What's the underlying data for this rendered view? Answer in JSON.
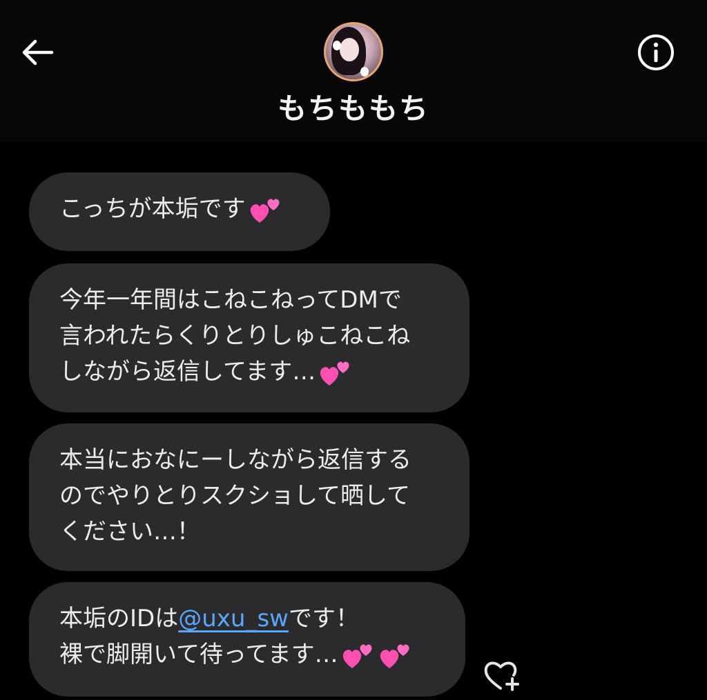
{
  "header": {
    "back_icon": "arrow-left-icon",
    "info_icon": "info-circle-icon",
    "display_name": "もちももち"
  },
  "messages": [
    {
      "lines": [
        "こっちが本垢です"
      ],
      "trailing_emoji": "two-hearts"
    },
    {
      "lines": [
        "今年一年間はこねこねってDMで",
        "言われたらくりとりしゅこねこね",
        "しながら返信してます…"
      ],
      "trailing_emoji": "two-hearts"
    },
    {
      "lines": [
        "本当におなにーしながら返信する",
        "のでやりとりスクショして晒して",
        "ください…！"
      ]
    },
    {
      "line1_prefix": "本垢のIDは",
      "mention": "@uxu_sw",
      "line1_suffix": "です！",
      "line2": "裸で脚開いて待ってます…",
      "trailing_emoji": "two-hearts"
    }
  ],
  "reaction": {
    "icon": "heart-plus-icon"
  },
  "colors": {
    "background": "#000000",
    "bubble": "#2b2b2e",
    "text": "#ececec",
    "link": "#5aa7ff",
    "avatar_ring": "#e7a66b",
    "heart": "#ff4fb0"
  }
}
